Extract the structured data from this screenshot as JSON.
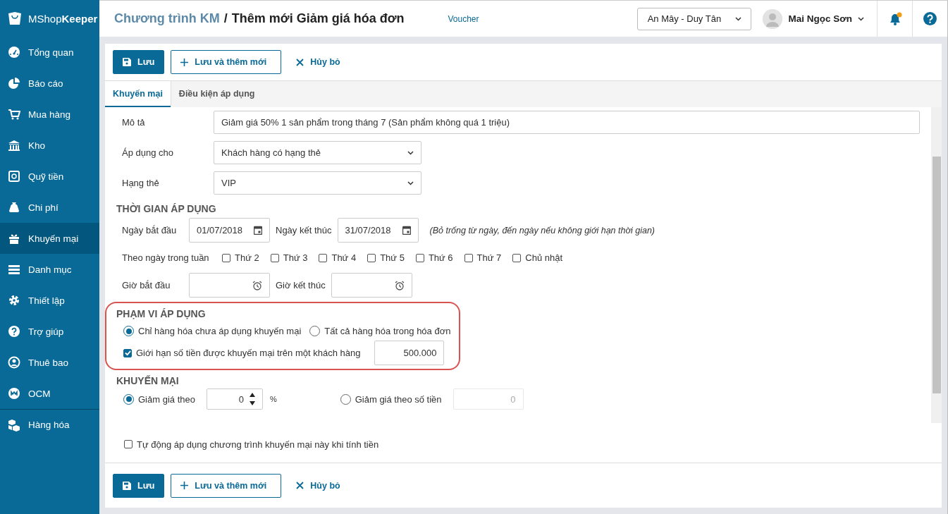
{
  "sidebar": {
    "brand_light": "MShop",
    "brand_bold": "Keeper",
    "items": [
      {
        "label": "Tổng quan",
        "selected": false
      },
      {
        "label": "Báo cáo",
        "selected": false
      },
      {
        "label": "Mua hàng",
        "selected": false
      },
      {
        "label": "Kho",
        "selected": false
      },
      {
        "label": "Quỹ tiền",
        "selected": false
      },
      {
        "label": "Chi phí",
        "selected": false
      },
      {
        "label": "Khuyến mại",
        "selected": true
      },
      {
        "label": "Danh mục",
        "selected": false
      },
      {
        "label": "Thiết lập",
        "selected": false
      },
      {
        "label": "Trợ giúp",
        "selected": false
      },
      {
        "label": "Thuê bao",
        "selected": false
      },
      {
        "label": "OCM",
        "selected": false
      },
      {
        "label": "Hàng hóa",
        "selected": false
      }
    ]
  },
  "header": {
    "breadcrumb": "Chương trình KM",
    "separator": "/",
    "title": "Thêm mới Giảm giá hóa đơn",
    "link": "Voucher",
    "store": "An Mây - Duy Tân",
    "user": "Mai Ngọc Sơn",
    "notification": true
  },
  "toolbar": [
    {
      "label": "Lưu",
      "kind": "primary"
    },
    {
      "label": "Lưu và thêm mới",
      "kind": "outline"
    },
    {
      "label": "Hủy bỏ",
      "kind": "text"
    }
  ],
  "tabs": [
    {
      "label": "Khuyến mại",
      "selected": true
    },
    {
      "label": "Điều kiện áp dụng",
      "selected": false
    }
  ],
  "fields": [
    {
      "label": "Mô tả",
      "kind": "text",
      "value": "Giảm giá 50% 1 sản phẩm trong tháng 7 (Sản phẩm không quá 1 triệu)"
    },
    {
      "label": "Áp dụng cho",
      "kind": "select",
      "value": "Khách hàng có hạng thẻ"
    },
    {
      "label": "Hạng thẻ",
      "kind": "select",
      "value": "VIP"
    }
  ],
  "time": {
    "title": "THỜI GIAN ÁP DỤNG",
    "start_label": "Ngày bắt đầu",
    "start": "01/07/2018",
    "end_label": "Ngày kết thúc",
    "end": "31/07/2018",
    "note": "(Bỏ trống từ ngày, đến ngày nếu không giới hạn thời gian)",
    "weekday_label": "Theo ngày trong tuần",
    "weekdays": [
      {
        "label": "Thứ 2",
        "checked": false
      },
      {
        "label": "Thứ 3",
        "checked": false
      },
      {
        "label": "Thứ 4",
        "checked": false
      },
      {
        "label": "Thứ 5",
        "checked": false
      },
      {
        "label": "Thứ 6",
        "checked": false
      },
      {
        "label": "Thứ 7",
        "checked": false
      },
      {
        "label": "Chủ nhật",
        "checked": false
      }
    ],
    "hour_start_label": "Giờ bắt đầu",
    "hour_end_label": "Giờ kết thúc"
  },
  "scope": {
    "title": "PHẠM VI ÁP DỤNG",
    "options": [
      {
        "label": "Chỉ hàng hóa chưa áp dụng khuyến mại",
        "selected": true
      },
      {
        "label": "Tất cả hàng hóa trong hóa đơn",
        "selected": false
      }
    ],
    "limit": {
      "label": "Giới hạn số tiền được khuyến mại trên một khách hàng",
      "checked": true,
      "value": "500.000"
    }
  },
  "promo": {
    "title": "KHUYẾN MẠI",
    "options": [
      {
        "label": "Giảm giá theo",
        "selected": true,
        "value": "0",
        "unit": "%"
      },
      {
        "label": "Giảm giá theo số tiền",
        "selected": false,
        "value": "0"
      }
    ]
  },
  "auto_apply": {
    "label": "Tự động áp dụng chương trình khuyến mại này khi tính tiền",
    "checked": false
  },
  "bottom_toolbar": [
    {
      "label": "Lưu",
      "kind": "primary"
    },
    {
      "label": "Lưu và thêm mới",
      "kind": "outline"
    },
    {
      "label": "Hủy bỏ",
      "kind": "text"
    }
  ]
}
